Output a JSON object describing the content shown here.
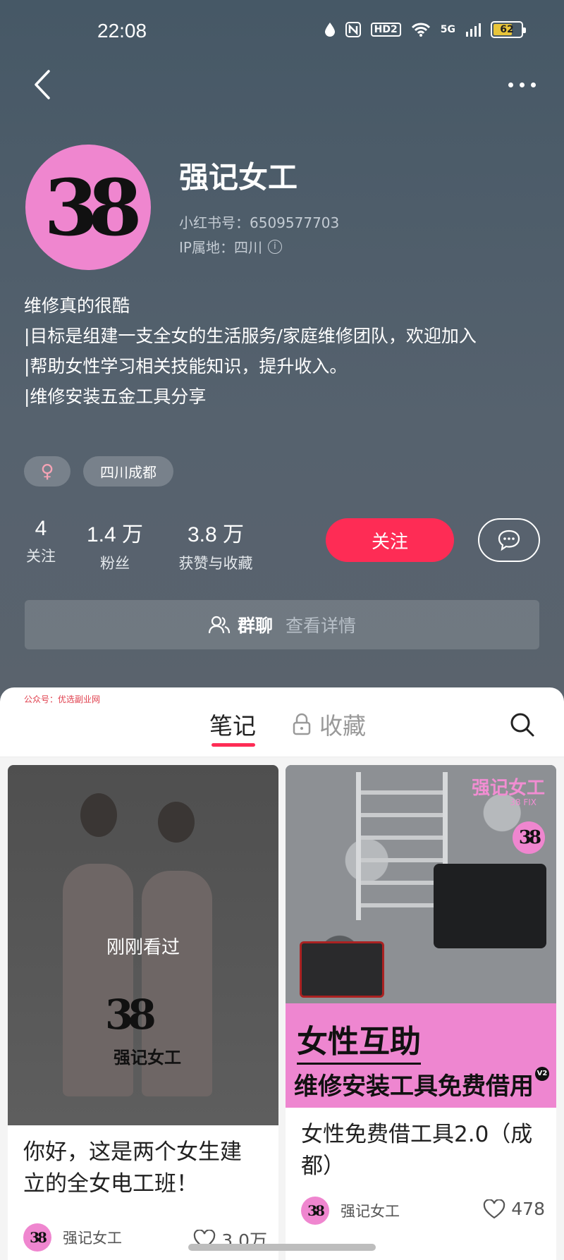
{
  "status_bar": {
    "time": "22:08",
    "hd_badge": "HD2",
    "network": "5G",
    "battery": "62"
  },
  "profile": {
    "name": "强记女工",
    "avatar_text": "38",
    "red_id": "小红书号：6509577703",
    "ip_location": "IP属地：四川",
    "bio_lines": [
      "维修真的很酷",
      "|目标是组建一支全女的生活服务/家庭维修团队，欢迎加入",
      "|帮助女性学习相关技能知识，提升收入。",
      "|维修安装五金工具分享"
    ],
    "tags": {
      "gender_symbol": "♀",
      "location": "四川成都"
    },
    "stats": [
      {
        "value": "4",
        "label": "关注"
      },
      {
        "value": "1.4 万",
        "label": "粉丝"
      },
      {
        "value": "3.8 万",
        "label": "获赞与收藏"
      }
    ],
    "follow_label": "关注",
    "group_chat": {
      "label": "群聊",
      "link": "查看详情"
    }
  },
  "watermark": "公众号：优选副业网",
  "tabs": {
    "notes": "笔记",
    "favorites": "收藏"
  },
  "notes": [
    {
      "cover_overlay": "刚刚看过",
      "cover_logo": "38",
      "cover_logo_text": "强记女工",
      "title": "你好，这是两个女生建立的全女电工班！",
      "author": "强记女工",
      "likes": "3.0万"
    },
    {
      "cover_brand": "强记女工",
      "cover_brand_sub": "38 FIX",
      "cover_badge": "38",
      "banner_line1": "女性互助",
      "banner_line2": "维修安装工具免费借用",
      "banner_badge": "V2",
      "title": "女性免费借工具2.0（成都）",
      "author": "强记女工",
      "likes": "478"
    }
  ],
  "colors": {
    "accent": "#fe2c55",
    "brand_pink": "#ef86cf",
    "header_bg": "#4b5a67"
  }
}
